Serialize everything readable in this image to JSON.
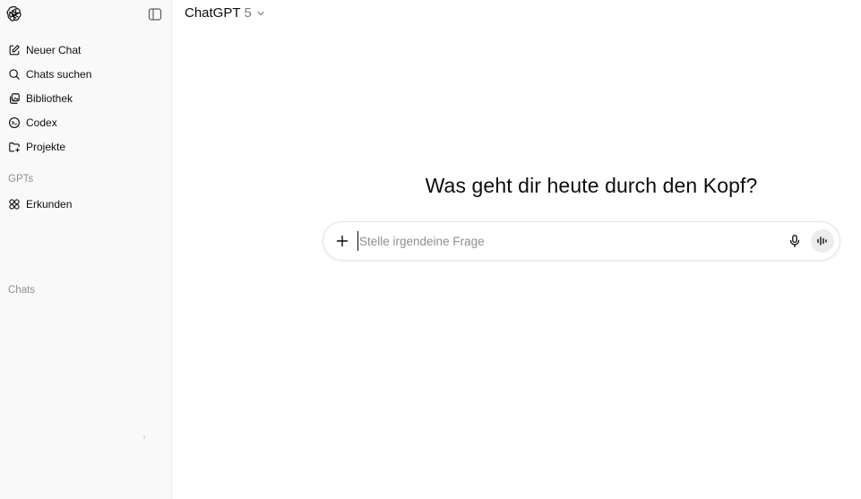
{
  "sidebar": {
    "logo_icon": "openai-logo-icon",
    "toggle_icon": "sidebar-toggle-icon",
    "items": [
      {
        "label": "Neuer Chat",
        "icon": "new-chat-icon"
      },
      {
        "label": "Chats suchen",
        "icon": "search-icon"
      },
      {
        "label": "Bibliothek",
        "icon": "library-icon"
      },
      {
        "label": "Codex",
        "icon": "codex-icon"
      },
      {
        "label": "Projekte",
        "icon": "folder-icon"
      }
    ],
    "gpts_label": "GPTs",
    "explore": {
      "label": "Erkunden",
      "icon": "grid-icon"
    },
    "chats_label": "Chats"
  },
  "header": {
    "model_name": "ChatGPT",
    "model_version": "5"
  },
  "main": {
    "headline": "Was geht dir heute durch den Kopf?",
    "composer": {
      "placeholder": "Stelle irgendeine Frage",
      "value": ""
    }
  },
  "colors": {
    "sidebar_bg": "#f9f9f9",
    "text": "#0d0d0d",
    "muted": "#8f8f8f"
  }
}
